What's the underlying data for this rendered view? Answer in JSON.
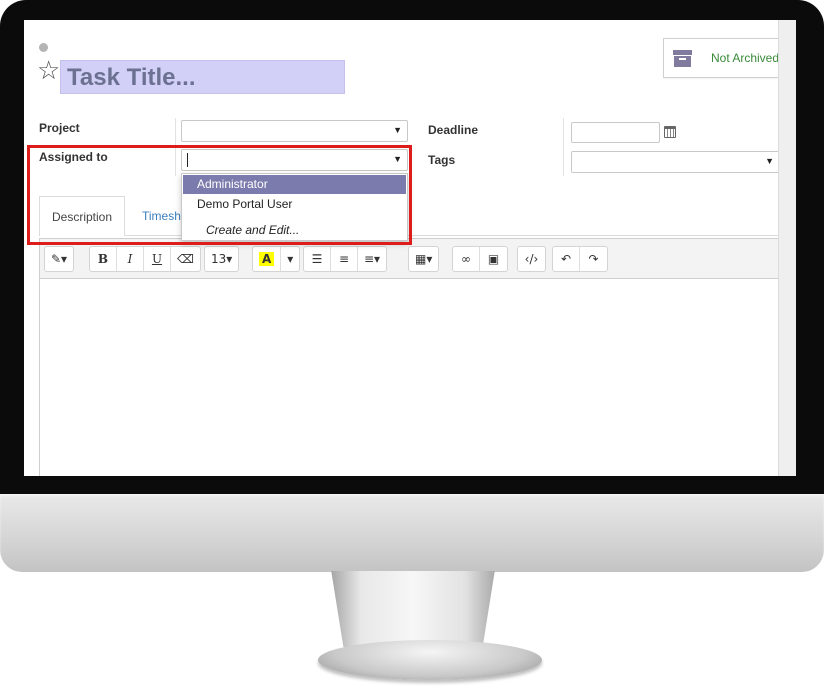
{
  "header": {
    "title": "Task Title...",
    "archive_label": "Not Archived"
  },
  "fields": {
    "project_label": "Project",
    "assigned_label": "Assigned to",
    "deadline_label": "Deadline",
    "tags_label": "Tags"
  },
  "dropdown": {
    "items": [
      "Administrator",
      "Demo Portal User"
    ],
    "create_label": "Create and Edit..."
  },
  "tabs": {
    "description": "Description",
    "timesheets": "Timesheets"
  },
  "toolbar": {
    "bold": "B",
    "italic": "I",
    "underline": "U",
    "font_size": "13",
    "font_color": "A"
  },
  "colors": {
    "highlight_border": "#dd1c1c",
    "title_background": "#d3d0f7",
    "active_item": "#7c7bad",
    "archive_text": "#3a8a3a"
  },
  "icons": [
    "star-icon",
    "archive-icon",
    "calendar-icon",
    "magic-wand-icon",
    "eraser-icon",
    "bullet-list-icon",
    "numbered-list-icon",
    "align-icon",
    "table-icon",
    "link-icon",
    "image-icon",
    "code-view-icon",
    "undo-icon",
    "redo-icon"
  ]
}
